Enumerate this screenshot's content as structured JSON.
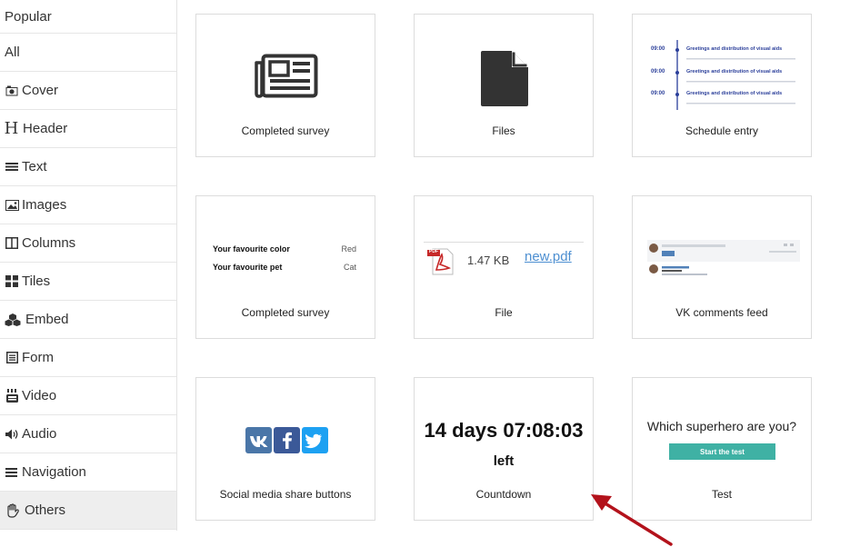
{
  "sidebar": {
    "items": [
      {
        "label": "Popular",
        "icon": ""
      },
      {
        "label": "All",
        "icon": ""
      },
      {
        "label": "Cover",
        "icon": "camera-icon"
      },
      {
        "label": "Header",
        "icon": "header-h-icon"
      },
      {
        "label": "Text",
        "icon": "text-lines-icon"
      },
      {
        "label": "Images",
        "icon": "image-icon"
      },
      {
        "label": "Columns",
        "icon": "columns-icon"
      },
      {
        "label": "Tiles",
        "icon": "tiles-icon"
      },
      {
        "label": "Embed",
        "icon": "cubes-icon"
      },
      {
        "label": "Form",
        "icon": "form-icon"
      },
      {
        "label": "Video",
        "icon": "youtube-icon"
      },
      {
        "label": "Audio",
        "icon": "speaker-icon"
      },
      {
        "label": "Navigation",
        "icon": "hamburger-icon"
      },
      {
        "label": "Others",
        "icon": "hand-icon"
      }
    ],
    "active": "Others",
    "header_glyph": "H"
  },
  "blocks": [
    {
      "label": "Completed survey",
      "icon": "newspaper-icon"
    },
    {
      "label": "Files",
      "icon": "file-icon"
    },
    {
      "label": "Schedule entry",
      "icon": "schedule-icon"
    },
    {
      "label": "Completed survey",
      "icon": "survey-table"
    },
    {
      "label": "File",
      "icon": "pdf-icon"
    },
    {
      "label": "VK comments feed",
      "icon": "comments-feed"
    },
    {
      "label": "Social media share buttons",
      "icon": "social-icons"
    },
    {
      "label": "Countdown",
      "icon": "countdown"
    },
    {
      "label": "Test",
      "icon": "test"
    }
  ],
  "schedule": {
    "times": [
      "09:00",
      "09:00",
      "09:00"
    ],
    "title": "Greetings and distribution of visual aids",
    "accent": "#2b3f9a"
  },
  "survey": {
    "rows": [
      {
        "q": "Your favourite color",
        "a": "Red"
      },
      {
        "q": "Your favourite pet",
        "a": "Cat"
      }
    ]
  },
  "file": {
    "size": "1.47 KB",
    "name": "new.pdf",
    "badge": "PDF"
  },
  "countdown": {
    "main": "14 days 07:08:03",
    "sub": "left"
  },
  "test": {
    "question": "Which superhero are you?",
    "button": "Start the test",
    "button_color": "#3fb1a4"
  },
  "social": {
    "colors": [
      "#4a76a8",
      "#3b5998",
      "#1da1f2"
    ]
  },
  "annotation": {
    "arrow_color": "#b3121b"
  }
}
